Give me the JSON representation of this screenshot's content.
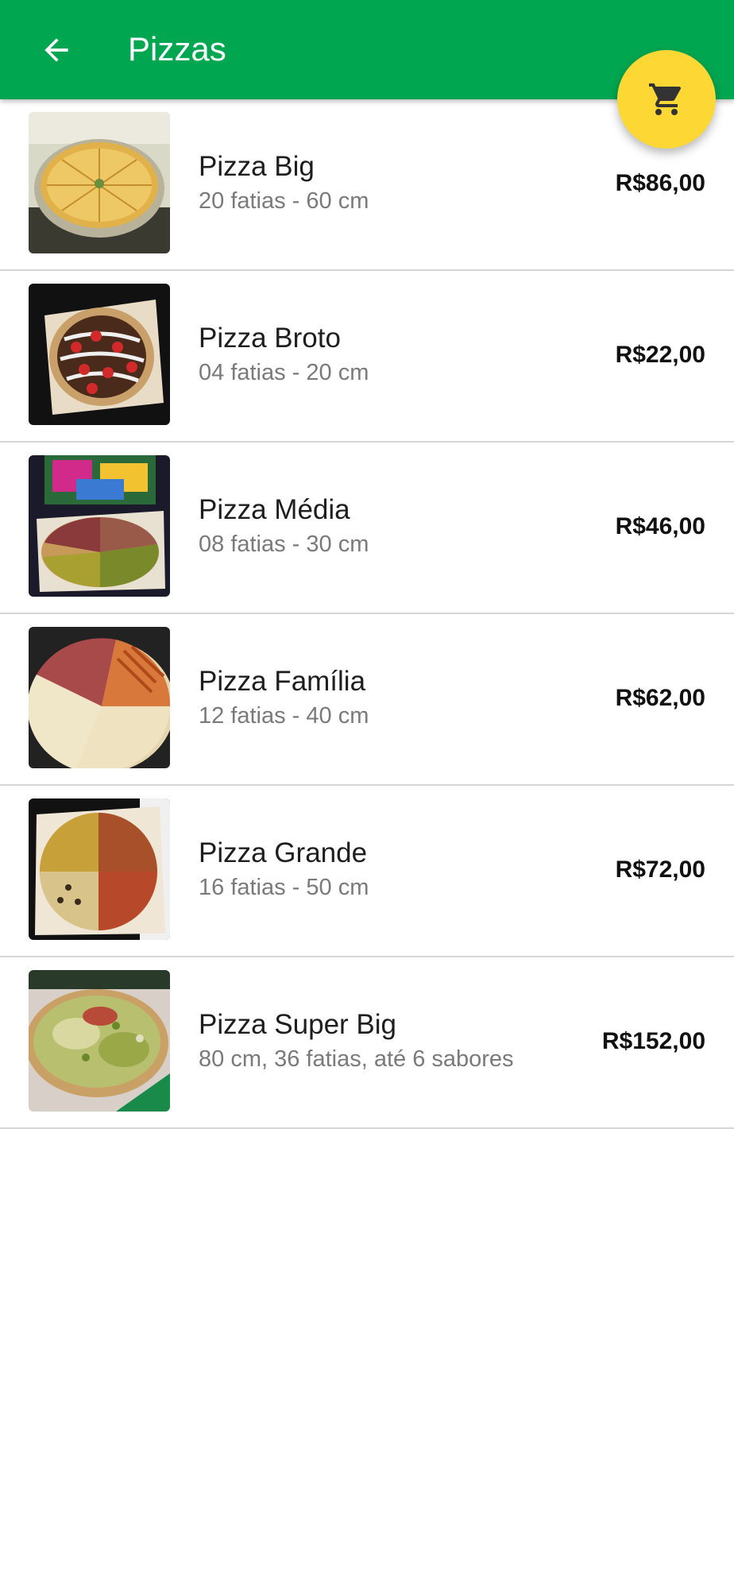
{
  "app_bar": {
    "title": "Pizzas",
    "color": "#00A650",
    "back_icon": "arrow-back-icon",
    "cart_icon": "shopping-cart-icon",
    "cart_fab_color": "#FDD835"
  },
  "items": [
    {
      "name": "Pizza Big",
      "description": "20 fatias - 60 cm",
      "price": "R$86,00"
    },
    {
      "name": "Pizza Broto",
      "description": "04 fatias - 20 cm",
      "price": "R$22,00"
    },
    {
      "name": "Pizza Média",
      "description": "08 fatias - 30 cm",
      "price": "R$46,00"
    },
    {
      "name": "Pizza Família",
      "description": "12 fatias - 40 cm",
      "price": "R$62,00"
    },
    {
      "name": "Pizza Grande",
      "description": "16 fatias - 50 cm",
      "price": "R$72,00"
    },
    {
      "name": "Pizza Super Big",
      "description": "80 cm, 36 fatias, até 6 sabores",
      "price": "R$152,00"
    }
  ]
}
